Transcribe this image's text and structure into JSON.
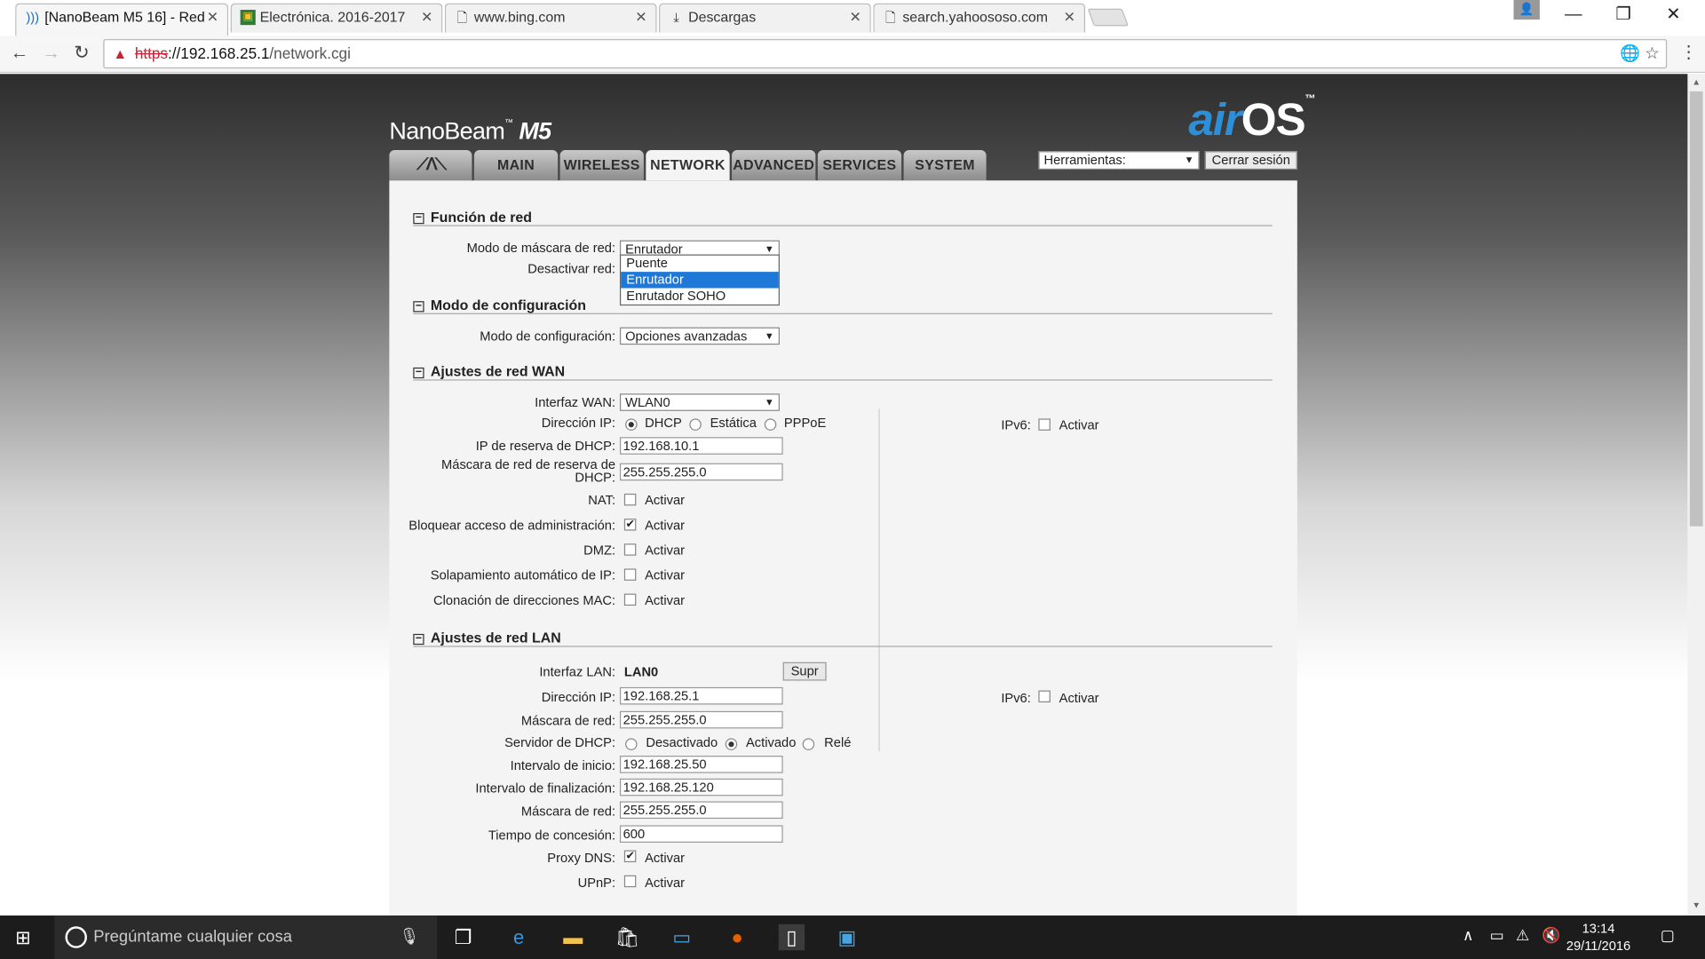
{
  "browser": {
    "tabs": [
      {
        "title": "[NanoBeam M5 16] - Red",
        "icon": "wifi-icon"
      },
      {
        "title": "Electrónica. 2016-2017",
        "icon": "classroom-icon"
      },
      {
        "title": "www.bing.com",
        "icon": "page-icon"
      },
      {
        "title": "Descargas",
        "icon": "download-icon"
      },
      {
        "title": "search.yahoososo.com",
        "icon": "page-icon"
      }
    ],
    "url_scheme": "https",
    "url_host": "://192.168.25.1",
    "url_path": "/network.cgi"
  },
  "header": {
    "brand": "NanoBeam",
    "brand_model": "M5",
    "logo_air": "air",
    "logo_os": "OS",
    "tabs": [
      "MAIN",
      "WIRELESS",
      "NETWORK",
      "ADVANCED",
      "SERVICES",
      "SYSTEM"
    ],
    "selected_tab": "NETWORK",
    "tools_label": "Herramientas:",
    "logout_label": "Cerrar sesión"
  },
  "network_role": {
    "title": "Función de red",
    "mode_label": "Modo de máscara de red:",
    "mode_value": "Enrutador",
    "mode_options": [
      "Puente",
      "Enrutador",
      "Enrutador SOHO"
    ],
    "disable_label": "Desactivar red:"
  },
  "config_mode": {
    "title": "Modo de configuración",
    "label": "Modo de configuración:",
    "value": "Opciones avanzadas"
  },
  "wan": {
    "title": "Ajustes de red WAN",
    "interface_label": "Interfaz WAN:",
    "interface_value": "WLAN0",
    "ip_label": "Dirección IP:",
    "ip_options": [
      "DHCP",
      "Estática",
      "PPPoE"
    ],
    "ipv6_label": "IPv6:",
    "activate": "Activar",
    "fallback_ip_label": "IP de reserva de DHCP:",
    "fallback_ip": "192.168.10.1",
    "fallback_mask_label": "Máscara de red de reserva de DHCP:",
    "fallback_mask": "255.255.255.0",
    "nat_label": "NAT:",
    "block_mgmt_label": "Bloquear acceso de administración:",
    "dmz_label": "DMZ:",
    "ip_alias_label": "Solapamiento automático de IP:",
    "mac_clone_label": "Clonación de direcciones MAC:"
  },
  "lan": {
    "title": "Ajustes de red LAN",
    "interface_label": "Interfaz LAN:",
    "interface_value": "LAN0",
    "delete_label": "Supr",
    "ip_label": "Dirección IP:",
    "ip_value": "192.168.25.1",
    "ipv6_label": "IPv6:",
    "activate": "Activar",
    "mask_label": "Máscara de red:",
    "mask_value": "255.255.255.0",
    "dhcp_label": "Servidor de DHCP:",
    "dhcp_options": [
      "Desactivado",
      "Activado",
      "Relé"
    ],
    "start_label": "Intervalo de inicio:",
    "start_value": "192.168.25.50",
    "end_label": "Intervalo de finalización:",
    "end_value": "192.168.25.120",
    "mask2_label": "Máscara de red:",
    "mask2_value": "255.255.255.0",
    "lease_label": "Tiempo de concesión:",
    "lease_value": "600",
    "dns_proxy_label": "Proxy DNS:",
    "upnp_label": "UPnP:"
  },
  "taskbar": {
    "search_placeholder": "Pregúntame cualquier cosa",
    "time": "13:14",
    "date": "29/11/2016"
  }
}
